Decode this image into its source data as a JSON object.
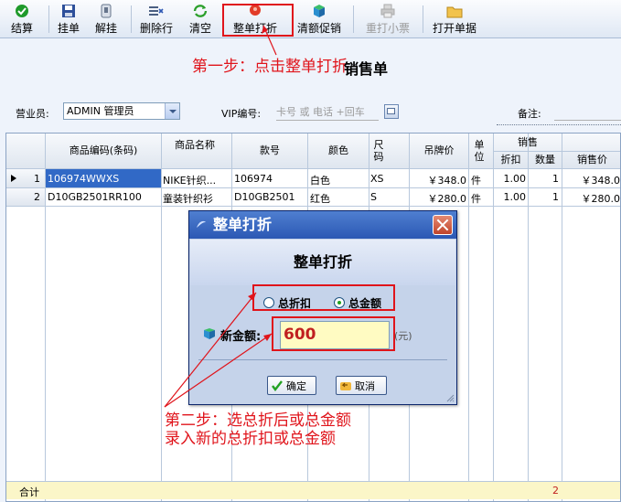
{
  "toolbar": {
    "items": [
      {
        "label": "结算",
        "icon": "checkmark-icon"
      },
      {
        "label": "挂单",
        "icon": "save-disk-icon"
      },
      {
        "label": "解挂",
        "icon": "unlock-icon"
      },
      {
        "label": "删除行",
        "icon": "delete-row-icon"
      },
      {
        "label": "清空",
        "icon": "refresh-icon"
      },
      {
        "label": "整单打折",
        "icon": "discount-tag-icon"
      },
      {
        "label": "清额促销",
        "icon": "promo-box-icon"
      },
      {
        "label": "重打小票",
        "icon": "printer-icon",
        "disabled": true
      },
      {
        "label": "打开单据",
        "icon": "folder-icon"
      }
    ]
  },
  "annotations": {
    "step1": "第一步：点击整单打折",
    "step2_line1": "第二步：选总折后或总金额",
    "step2_line2": "录入新的总折扣或总金额"
  },
  "form": {
    "title": "销售单",
    "salesperson_label": "营业员:",
    "salesperson_value": "ADMIN 管理员",
    "vip_label": "VIP编号:",
    "vip_placeholder": "卡号 或 电话 +回车",
    "note_label": "备注:"
  },
  "grid": {
    "headers": {
      "code": "商品编码(条码)",
      "name": "商品名称",
      "style": "款号",
      "color": "颜色",
      "size": "尺码",
      "tag_price": "吊牌价",
      "unit": "单位",
      "sales_group": "销售",
      "discount": "折扣",
      "qty": "数量",
      "sale_price": "销售价"
    },
    "rows": [
      {
        "index": "1",
        "code": "106974WWXS",
        "name": "NIKE针织...",
        "style": "106974",
        "color": "白色",
        "size": "XS",
        "tag_price": "￥348.0",
        "unit": "件",
        "discount": "1.00",
        "qty": "1",
        "sale_price": "￥348.0"
      },
      {
        "index": "2",
        "code": "D10GB2501RR100",
        "name": "童装针织衫",
        "style": "D10GB2501",
        "color": "红色",
        "size": "S",
        "tag_price": "￥280.0",
        "unit": "件",
        "discount": "1.00",
        "qty": "1",
        "sale_price": "￥280.0"
      }
    ],
    "total_label": "合计",
    "total_qty": "2"
  },
  "dialog": {
    "title": "整单打折",
    "heading": "整单打折",
    "option_total_discount": "总折扣",
    "option_total_amount": "总金额",
    "selected_option": "总金额",
    "new_amount_label": "新金额:",
    "new_amount_value": "600",
    "unit": "(元)",
    "ok_label": "确定",
    "cancel_label": "取消"
  },
  "colors": {
    "highlight": "#e0141b",
    "selected_row": "#3169c6",
    "input_bg": "#fffbc2"
  }
}
